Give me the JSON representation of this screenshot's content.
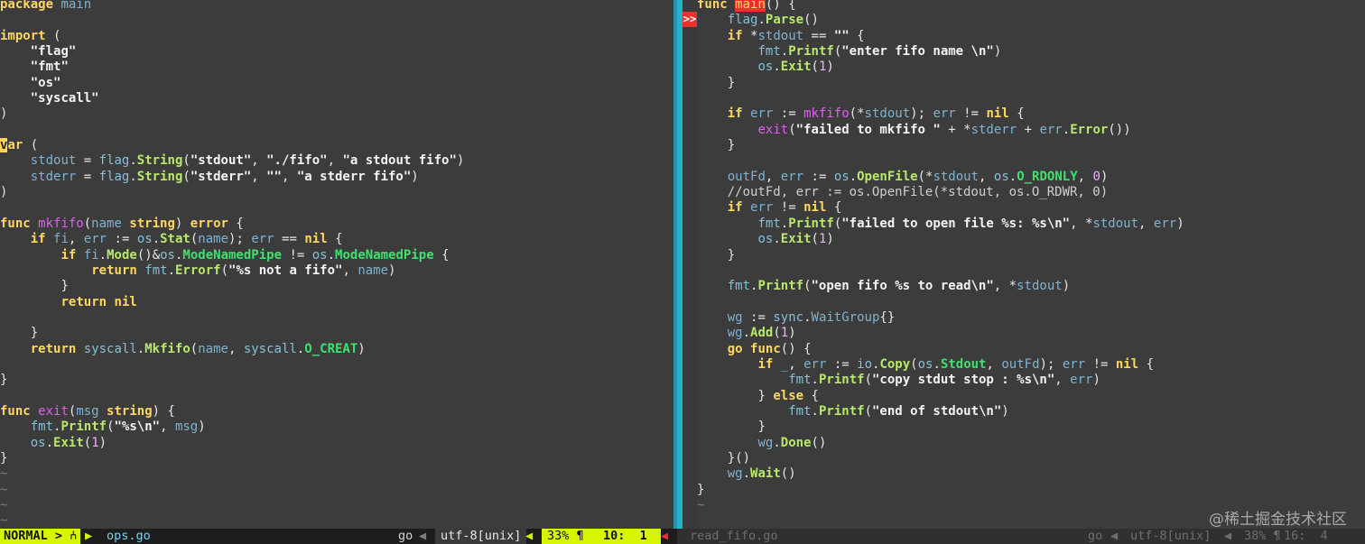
{
  "left_buffer": {
    "filename": "ops.go",
    "mode": "NORMAL",
    "mode_sep": ">",
    "branch_glyph": "⑃",
    "filetype": "go",
    "encoding": "utf-8[unix]",
    "percent": "33% ¶",
    "line_col": "10:  1",
    "lines": [
      "package main",
      "",
      "import (",
      "    \"flag\"",
      "    \"fmt\"",
      "    \"os\"",
      "    \"syscall\"",
      ")",
      "",
      "var (",
      "    stdout = flag.String(\"stdout\", \"./fifo\", \"a stdout fifo\")",
      "    stderr = flag.String(\"stderr\", \"\", \"a stderr fifo\")",
      ")",
      "",
      "func mkfifo(name string) error {",
      "    if fi, err := os.Stat(name); err == nil {",
      "        if fi.Mode()&os.ModeNamedPipe != os.ModeNamedPipe {",
      "            return fmt.Errorf(\"%s not a fifo\", name)",
      "        }",
      "        return nil",
      "",
      "    }",
      "    return syscall.Mkfifo(name, syscall.O_CREAT)",
      "",
      "}",
      "",
      "func exit(msg string) {",
      "    fmt.Printf(\"%s\\n\", msg)",
      "    os.Exit(1)",
      "}",
      "~",
      "~",
      "~",
      "~"
    ]
  },
  "right_buffer": {
    "filename": "read_fifo.go",
    "sign": ">>",
    "filetype": "go",
    "encoding": "utf-8[unix]",
    "percent": "38% ¶",
    "line_col": "16:  4",
    "lines": [
      "func main() {",
      "    flag.Parse()",
      "    if *stdout == \"\" {",
      "        fmt.Printf(\"enter fifo name \\n\")",
      "        os.Exit(1)",
      "    }",
      "",
      "    if err := mkfifo(*stdout); err != nil {",
      "        exit(\"failed to mkfifo \" + *stderr + err.Error())",
      "    }",
      "",
      "    outFd, err := os.OpenFile(*stdout, os.O_RDONLY, 0)",
      "    //outFd, err := os.OpenFile(*stdout, os.O_RDWR, 0)",
      "    if err != nil {",
      "        fmt.Printf(\"failed to open file %s: %s\\n\", *stdout, err)",
      "        os.Exit(1)",
      "    }",
      "",
      "    fmt.Printf(\"open fifo %s to read\\n\", *stdout)",
      "",
      "    wg := sync.WaitGroup{}",
      "    wg.Add(1)",
      "    go func() {",
      "        if _, err := io.Copy(os.Stdout, outFd); err != nil {",
      "            fmt.Printf(\"copy stdut stop : %s\\n\", err)",
      "        } else {",
      "            fmt.Printf(\"end of stdout\\n\")",
      "        }",
      "        wg.Done()",
      "    }()",
      "    wg.Wait()",
      "}",
      "~"
    ]
  },
  "watermark": "@稀土掘金技术社区",
  "colors": {
    "background": "#3c3c3c",
    "keyword": "#ffd75f",
    "function": "#b8e86b",
    "string": "#f4f4f4",
    "constant": "#40e070",
    "package": "#86c0d8",
    "airline_accent": "#d7f500",
    "sign_column": "#e8322e",
    "split_separator": "#1fb4c8"
  }
}
